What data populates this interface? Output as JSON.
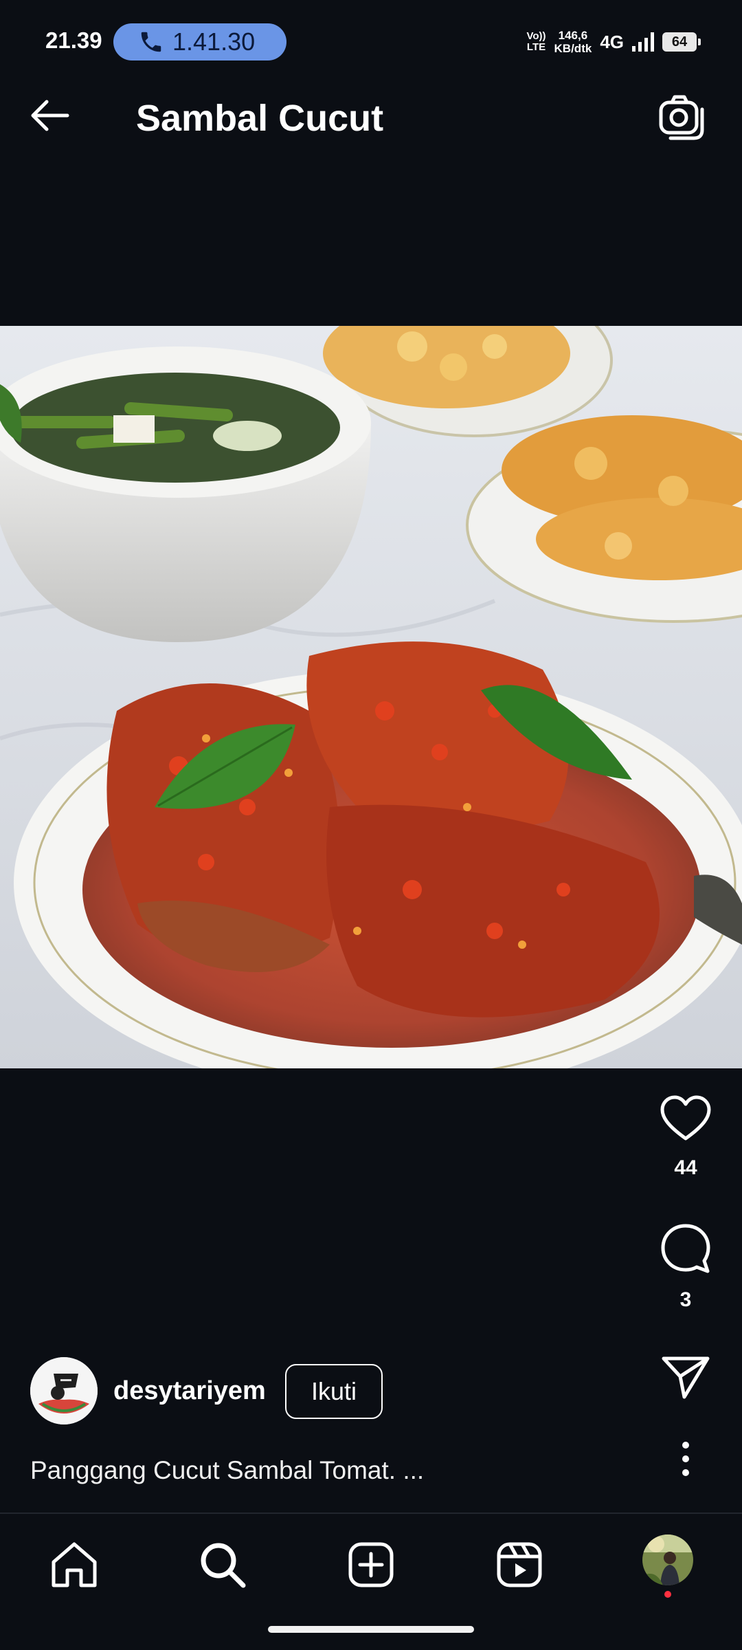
{
  "status_bar": {
    "time": "21.39",
    "call_timer": "1.41.30",
    "volte_line1": "Vo))",
    "volte_line2": "LTE",
    "speed_line1": "146,6",
    "speed_line2": "KB/dtk",
    "network": "4G",
    "battery": "64"
  },
  "header": {
    "title": "Sambal Cucut",
    "back_icon": "arrow-left-icon",
    "camera_icon": "camera-icon"
  },
  "post": {
    "image_description_icon": "food-photo",
    "likes": "44",
    "comments": "3",
    "author": {
      "username": "desytariyem",
      "follow_label": "Ikuti"
    },
    "caption": "Panggang Cucut Sambal Tomat. ..."
  },
  "bottom_nav": {
    "items": [
      "home-icon",
      "search-icon",
      "create-icon",
      "reels-icon",
      "profile-avatar"
    ]
  },
  "colors": {
    "background": "#0b0e14",
    "call_pill": "#6a95e6",
    "notification": "#ff3040"
  }
}
